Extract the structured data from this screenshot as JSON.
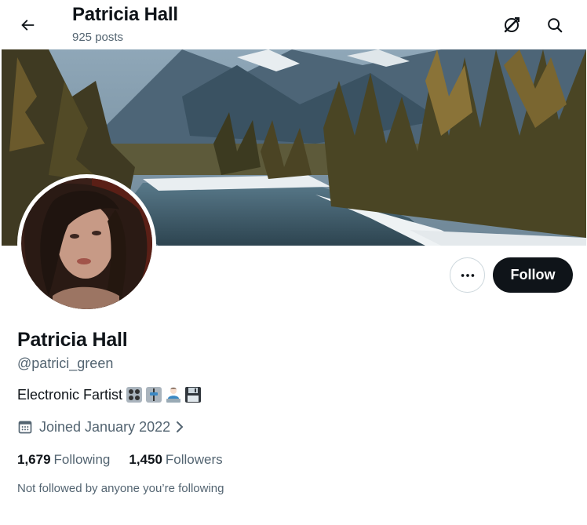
{
  "header": {
    "title": "Patricia Hall",
    "post_count": "925 posts",
    "back_icon": "arrow-left-icon",
    "grok_icon": "grok-icon",
    "search_icon": "search-icon"
  },
  "profile": {
    "name": "Patricia Hall",
    "handle": "@patrici_green",
    "bio": "Electronic Fartist",
    "bio_emojis": [
      "control-knobs-emoji",
      "level-slider-emoji",
      "technologist-emoji",
      "floppy-disk-emoji"
    ],
    "joined": "Joined January 2022",
    "following_count": "1,679",
    "following_label": "Following",
    "followers_count": "1,450",
    "followers_label": "Followers",
    "not_followed_note": "Not followed by anyone you’re following"
  },
  "actions": {
    "more_icon": "more-horizontal-icon",
    "follow_label": "Follow"
  },
  "colors": {
    "text_primary": "#0f1419",
    "text_secondary": "#536471",
    "follow_bg": "#0f1419",
    "border": "#cfd9de"
  }
}
